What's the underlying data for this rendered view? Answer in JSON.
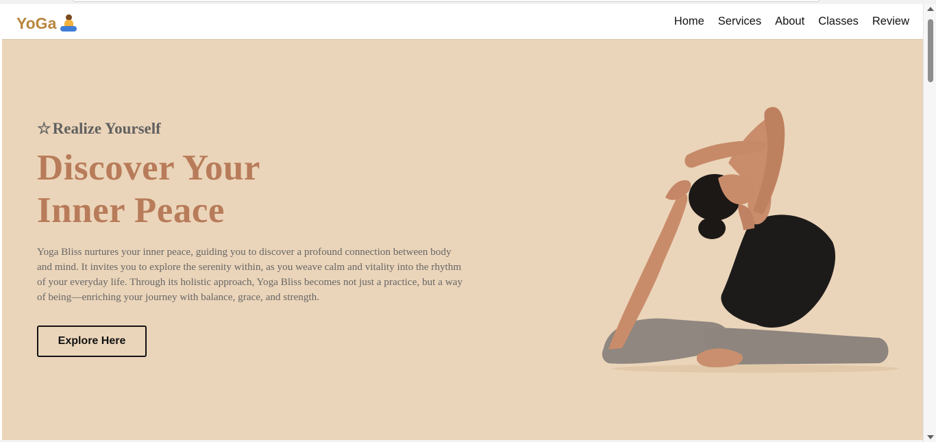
{
  "navbar": {
    "logo_text": "YoGa",
    "logo_icon": "person-in-lotus-position-emoji",
    "links": [
      {
        "label": "Home"
      },
      {
        "label": "Services"
      },
      {
        "label": "About"
      },
      {
        "label": "Classes"
      },
      {
        "label": "Review"
      }
    ]
  },
  "hero": {
    "eyebrow_icon": "☆",
    "eyebrow_text": "Realize Yourself",
    "headline_line1": "Discover Your",
    "headline_line2": "Inner Peace",
    "paragraph": "Yoga Bliss nurtures your inner peace, guiding you to discover a profound connection between body and mind. It invites you to explore the serenity within, as you weave calm and vitality into the rhythm of your everyday life. Through its holistic approach, Yoga Bliss becomes not just a practice, but a way of being—enriching your journey with balance, grace, and strength.",
    "cta_label": "Explore Here",
    "image_subject": "woman-in-yoga-pose-photo"
  },
  "colors": {
    "hero_background": "#ebd5ba",
    "headline": "#b87c5a",
    "logo": "#b8863f",
    "eyebrow": "#606060",
    "paragraph": "#666666"
  }
}
